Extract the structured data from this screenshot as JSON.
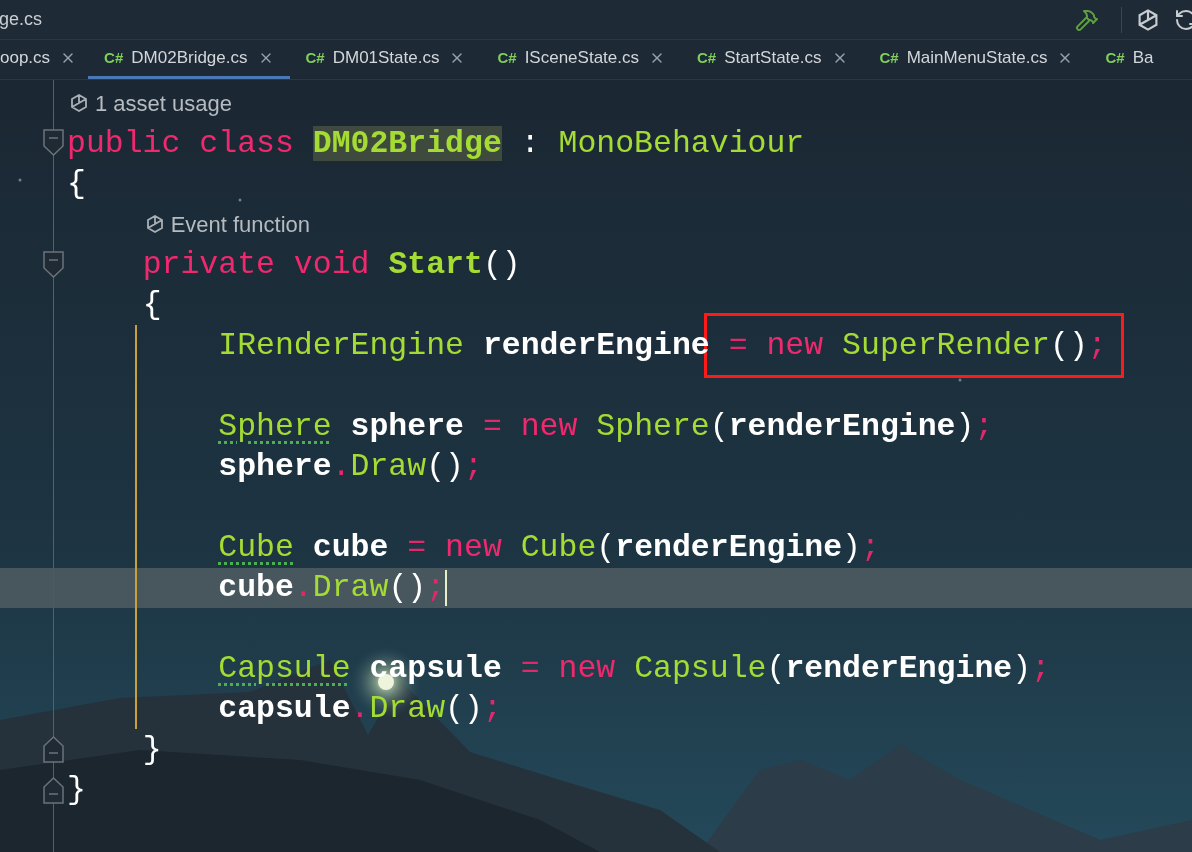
{
  "window": {
    "title": "ge.cs"
  },
  "tabs": [
    {
      "label": "oop.cs",
      "selected": false,
      "closable": true
    },
    {
      "badge": "C#",
      "label": "DM02Bridge.cs",
      "selected": true,
      "closable": true
    },
    {
      "badge": "C#",
      "label": "DM01State.cs",
      "selected": false,
      "closable": true
    },
    {
      "badge": "C#",
      "label": "ISceneState.cs",
      "selected": false,
      "closable": true
    },
    {
      "badge": "C#",
      "label": "StartState.cs",
      "selected": false,
      "closable": true
    },
    {
      "badge": "C#",
      "label": "MainMenuState.cs",
      "selected": false,
      "closable": true
    },
    {
      "badge": "C#",
      "label": "Ba",
      "selected": false,
      "closable": false
    }
  ],
  "editor": {
    "rows": [
      {
        "kind": "hint",
        "text": "1 asset usage"
      },
      {
        "kind": "code",
        "fold": {
          "kind": "start"
        },
        "changed": false,
        "current": false,
        "tokens": [
          {
            "kind": "keyword",
            "text": "public "
          },
          {
            "kind": "keyword",
            "text": "class "
          },
          {
            "kind": "decl_marked",
            "text": "DM02Bridge"
          },
          {
            "kind": "plain",
            "text": " : "
          },
          {
            "kind": "type",
            "text": "MonoBehaviour"
          }
        ]
      },
      {
        "kind": "code",
        "changed": false,
        "current": false,
        "tokens": [
          {
            "kind": "plain",
            "text": "{"
          }
        ]
      },
      {
        "kind": "hint",
        "text": "    Event function"
      },
      {
        "kind": "code",
        "fold": {
          "kind": "start"
        },
        "changed": false,
        "current": false,
        "tokens": [
          {
            "kind": "keyword",
            "text": "    private "
          },
          {
            "kind": "keyword",
            "text": "void "
          },
          {
            "kind": "decl",
            "text": "Start"
          },
          {
            "kind": "plain",
            "text": "()"
          }
        ]
      },
      {
        "kind": "code",
        "changed": false,
        "current": false,
        "tokens": [
          {
            "kind": "plain",
            "text": "    {"
          }
        ]
      },
      {
        "kind": "code",
        "changed": true,
        "current": false,
        "tokens": [
          {
            "kind": "type",
            "text": "        IRenderEngine "
          },
          {
            "kind": "ident",
            "text": "renderEngine"
          }
        ],
        "framed_tokens": [
          {
            "kind": "op",
            "text": " = "
          },
          {
            "kind": "keyword",
            "text": "new "
          },
          {
            "kind": "type",
            "text": "SuperRender"
          },
          {
            "kind": "plain",
            "text": "()"
          },
          {
            "kind": "op",
            "text": ";"
          }
        ]
      },
      {
        "kind": "blank",
        "changed": true
      },
      {
        "kind": "code",
        "changed": true,
        "current": false,
        "tokens": [
          {
            "kind": "type_hint",
            "text": "        Sphere"
          },
          {
            "kind": "ident",
            "text": " sphere "
          },
          {
            "kind": "op",
            "text": "= "
          },
          {
            "kind": "keyword",
            "text": "new "
          },
          {
            "kind": "type",
            "text": "Sphere"
          },
          {
            "kind": "plain",
            "text": "("
          },
          {
            "kind": "ident",
            "text": "renderEngine"
          },
          {
            "kind": "plain",
            "text": ")"
          },
          {
            "kind": "op",
            "text": ";"
          }
        ]
      },
      {
        "kind": "code",
        "changed": true,
        "current": false,
        "tokens": [
          {
            "kind": "ident",
            "text": "        sphere"
          },
          {
            "kind": "op",
            "text": "."
          },
          {
            "kind": "method",
            "text": "Draw"
          },
          {
            "kind": "plain",
            "text": "()"
          },
          {
            "kind": "op",
            "text": ";"
          }
        ]
      },
      {
        "kind": "blank",
        "changed": true
      },
      {
        "kind": "code",
        "changed": true,
        "current": false,
        "tokens": [
          {
            "kind": "type_hint",
            "text": "        Cube"
          },
          {
            "kind": "ident",
            "text": " cube "
          },
          {
            "kind": "op",
            "text": "= "
          },
          {
            "kind": "keyword",
            "text": "new "
          },
          {
            "kind": "type",
            "text": "Cube"
          },
          {
            "kind": "plain",
            "text": "("
          },
          {
            "kind": "ident",
            "text": "renderEngine"
          },
          {
            "kind": "plain",
            "text": ")"
          },
          {
            "kind": "op",
            "text": ";"
          }
        ]
      },
      {
        "kind": "code",
        "changed": true,
        "current": true,
        "tokens": [
          {
            "kind": "ident",
            "text": "        cube"
          },
          {
            "kind": "op",
            "text": "."
          },
          {
            "kind": "method",
            "text": "Draw"
          },
          {
            "kind": "plain",
            "text": "()"
          },
          {
            "kind": "op",
            "text": ";"
          }
        ]
      },
      {
        "kind": "blank",
        "changed": true
      },
      {
        "kind": "code",
        "changed": true,
        "current": false,
        "tokens": [
          {
            "kind": "type_hint",
            "text": "        Capsule"
          },
          {
            "kind": "ident",
            "text": " capsule "
          },
          {
            "kind": "op",
            "text": "= "
          },
          {
            "kind": "keyword",
            "text": "new "
          },
          {
            "kind": "type",
            "text": "Capsule"
          },
          {
            "kind": "plain",
            "text": "("
          },
          {
            "kind": "ident",
            "text": "renderEngine"
          },
          {
            "kind": "plain",
            "text": ")"
          },
          {
            "kind": "op",
            "text": ";"
          }
        ]
      },
      {
        "kind": "code",
        "changed": true,
        "current": false,
        "tokens": [
          {
            "kind": "ident",
            "text": "        capsule"
          },
          {
            "kind": "op",
            "text": "."
          },
          {
            "kind": "method",
            "text": "Draw"
          },
          {
            "kind": "plain",
            "text": "()"
          },
          {
            "kind": "op",
            "text": ";"
          }
        ]
      },
      {
        "kind": "code",
        "fold": {
          "kind": "end"
        },
        "changed": false,
        "current": false,
        "tokens": [
          {
            "kind": "plain",
            "text": "    }"
          }
        ]
      },
      {
        "kind": "code",
        "fold": {
          "kind": "end"
        },
        "changed": false,
        "current": false,
        "tokens": [
          {
            "kind": "plain",
            "text": "}"
          }
        ]
      }
    ]
  }
}
